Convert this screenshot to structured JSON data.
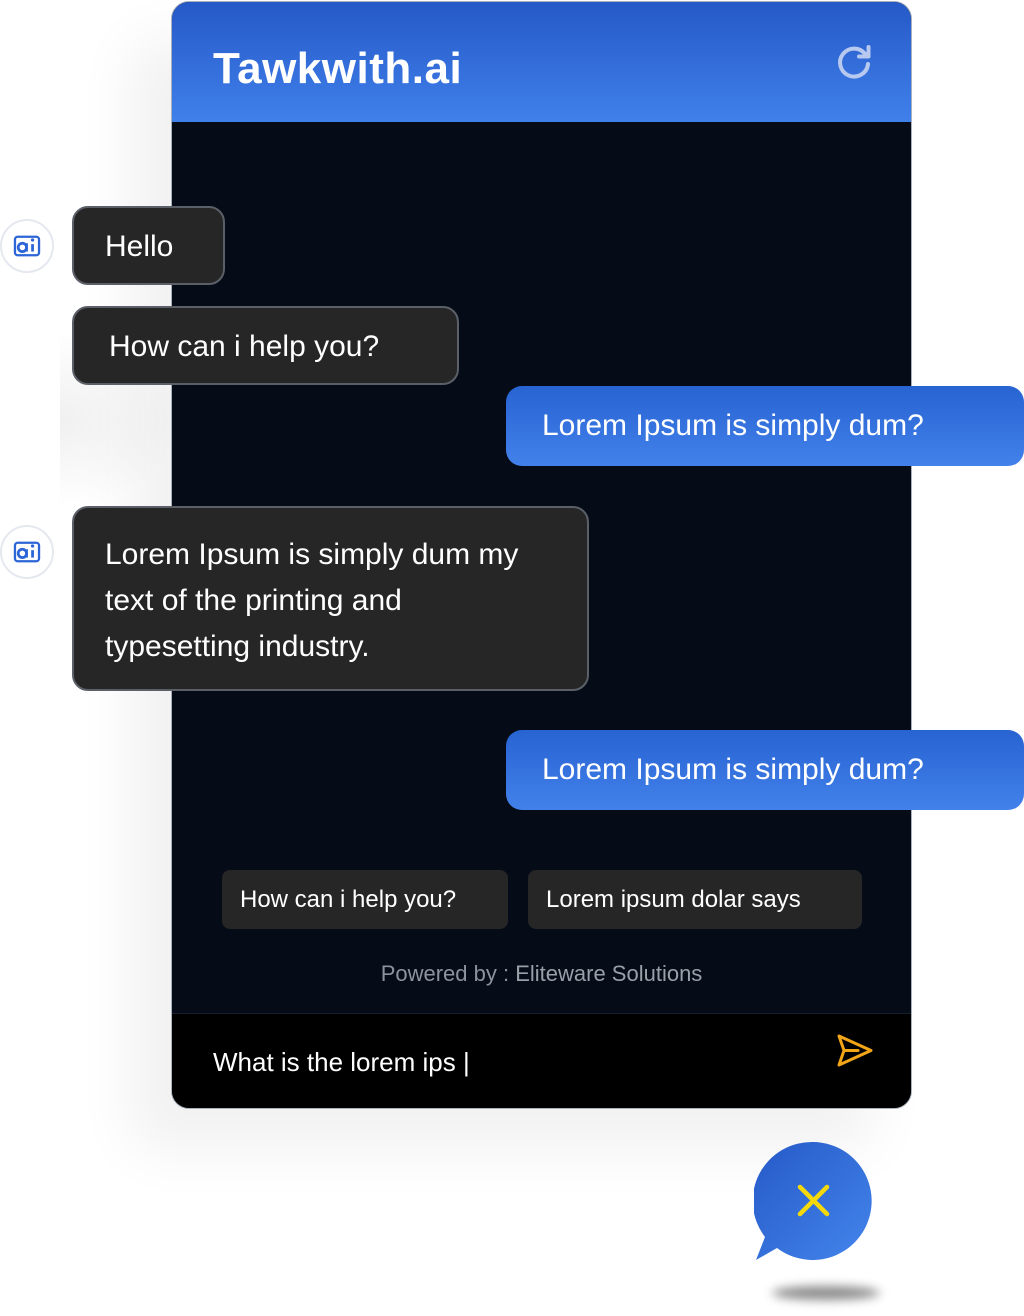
{
  "app": {
    "title": "Tawkwith.ai"
  },
  "messages": {
    "m1": "Hello",
    "m2": "How can i help you?",
    "m3": "Lorem Ipsum is simply dum?",
    "m4_line1": "Lorem Ipsum is simply dum my",
    "m4_line2": "text of the printing and",
    "m4_line3": "typesetting industry.",
    "m5": "Lorem Ipsum is simply dum?"
  },
  "quick_replies": [
    "How can i help you?",
    "Lorem ipsum dolar says"
  ],
  "footer": {
    "powered_label": "Powered by : ",
    "powered_brand": "Eliteware Solutions"
  },
  "input": {
    "value": "What is the lorem ips |"
  },
  "icons": {
    "refresh": "refresh-icon",
    "avatar": "ai-logo-icon",
    "send": "send-icon",
    "close": "close-icon"
  },
  "colors": {
    "brand_blue": "#2c66d6",
    "header_gradient_top": "#2559c7",
    "header_gradient_bottom": "#4080ea",
    "chat_background": "#050c17",
    "bot_bubble": "#262626",
    "send_icon": "#f2a516",
    "close_icon": "#f5d90a"
  }
}
